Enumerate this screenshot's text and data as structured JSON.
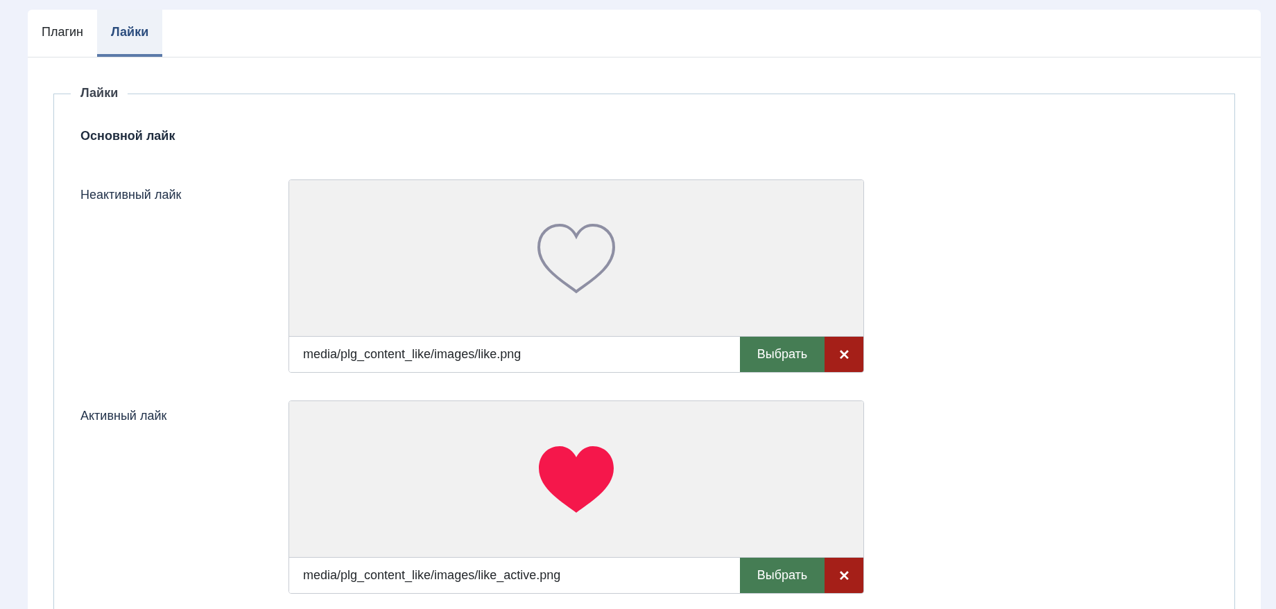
{
  "tabs": [
    {
      "label": "Плагин",
      "selected": false
    },
    {
      "label": "Лайки",
      "selected": true
    }
  ],
  "fieldset": {
    "legend": "Лайки",
    "heading": "Основной лайк",
    "fields": [
      {
        "label": "Неактивный лайк",
        "preview": {
          "kind": "outline-heart"
        },
        "value": "media/plg_content_like/images/like.png",
        "select_button": "Выбрать",
        "clear_button": "✕"
      },
      {
        "label": "Активный лайк",
        "preview": {
          "kind": "filled-heart"
        },
        "value": "media/plg_content_like/images/like_active.png",
        "select_button": "Выбрать",
        "clear_button": "✕"
      }
    ]
  }
}
